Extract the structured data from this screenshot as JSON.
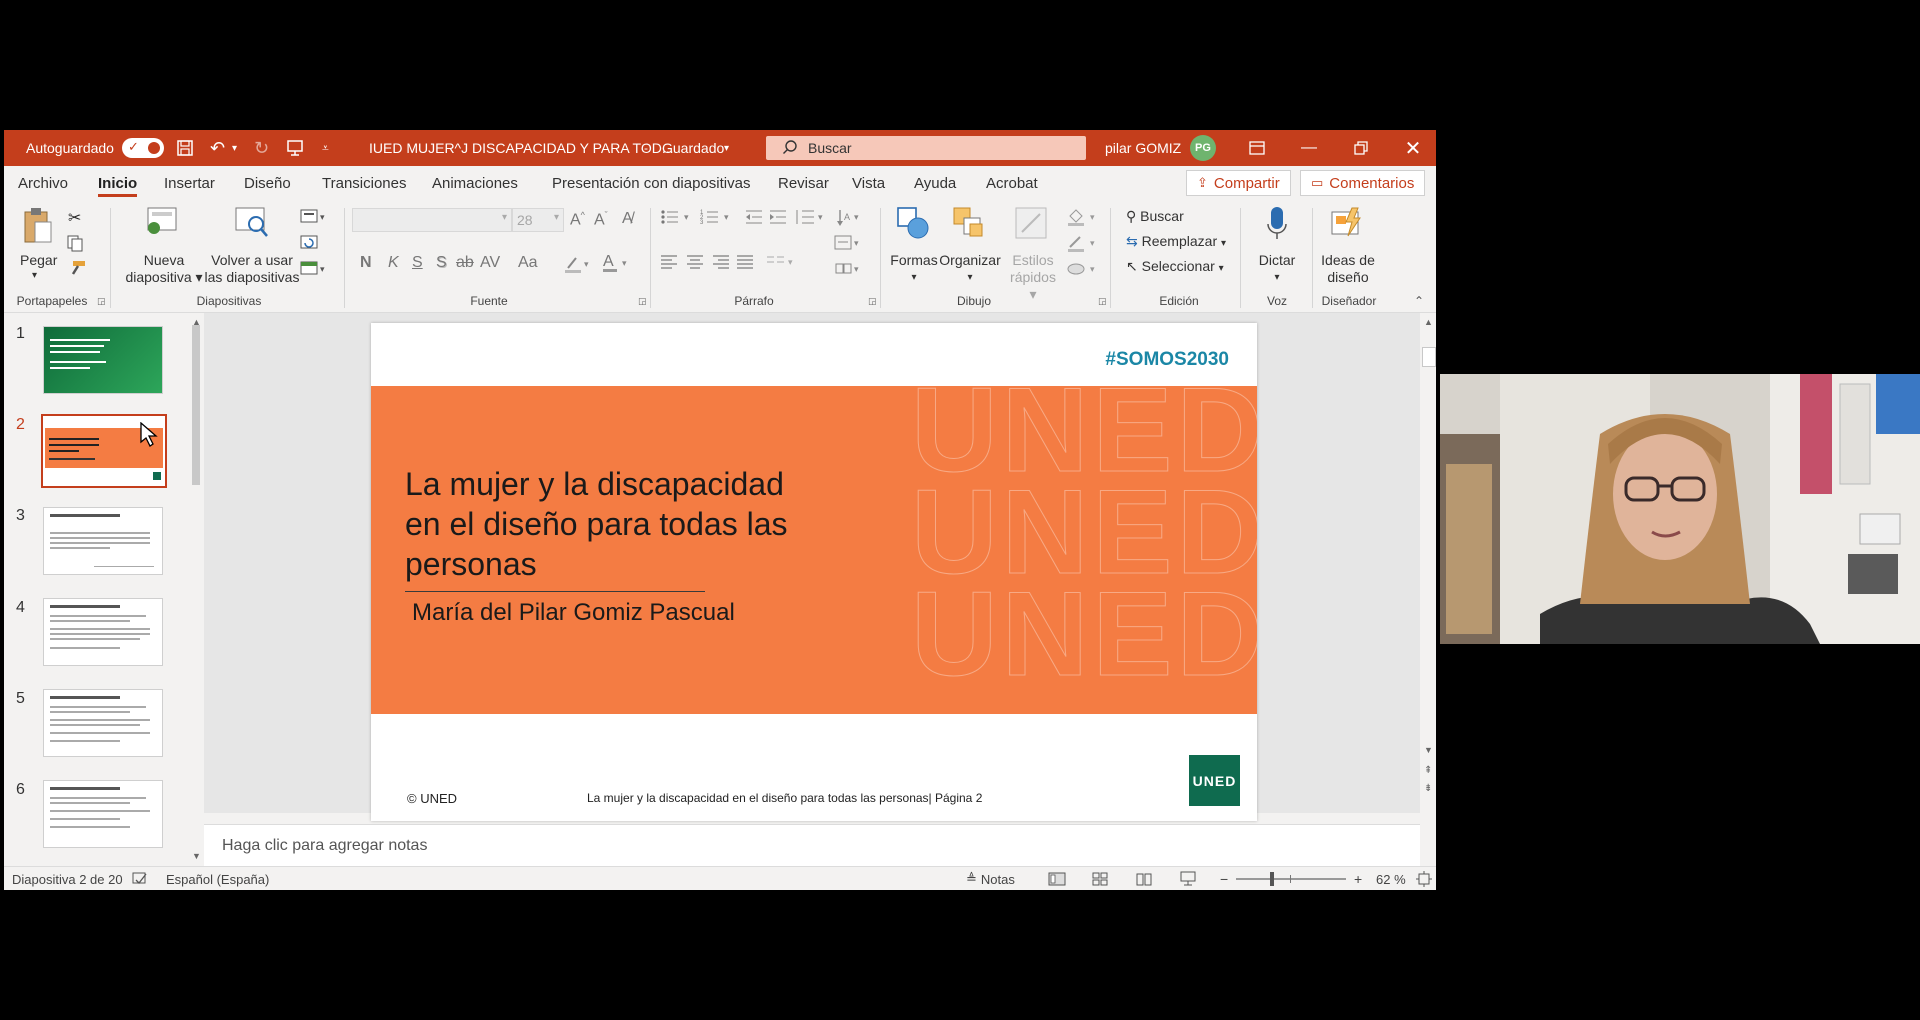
{
  "titlebar": {
    "autosave_label": "Autoguardado",
    "doc_title": "IUED MUJER^J DISCAPACIDAD Y PARA TOD...",
    "saved_status": "Guardado",
    "search_placeholder": "Buscar",
    "user_name": "pilar GOMIZ",
    "user_initials": "PG"
  },
  "menu": {
    "tabs": [
      "Archivo",
      "Inicio",
      "Insertar",
      "Diseño",
      "Transiciones",
      "Animaciones",
      "Presentación con diapositivas",
      "Revisar",
      "Vista",
      "Ayuda",
      "Acrobat"
    ],
    "active_tab": "Inicio",
    "share_label": "Compartir",
    "comments_label": "Comentarios"
  },
  "ribbon": {
    "paste_label": "Pegar",
    "new_slide_line1": "Nueva",
    "new_slide_line2": "diapositiva",
    "reuse_line1": "Volver a usar",
    "reuse_line2": "las diapositivas",
    "font_size": "28",
    "shapes_label": "Formas",
    "arrange_label": "Organizar",
    "styles_line1": "Estilos",
    "styles_line2": "rápidos",
    "find_label": "Buscar",
    "replace_label": "Reemplazar",
    "select_label": "Seleccionar",
    "dictate_label": "Dictar",
    "ideas_line1": "Ideas de",
    "ideas_line2": "diseño",
    "groups": {
      "clipboard": "Portapapeles",
      "slides": "Diapositivas",
      "font": "Fuente",
      "paragraph": "Párrafo",
      "drawing": "Dibujo",
      "editing": "Edición",
      "voice": "Voz",
      "designer": "Diseñador"
    },
    "format_buttons": [
      "N",
      "K",
      "S",
      "S",
      "ab",
      "AV",
      "Aa"
    ]
  },
  "thumbnails": {
    "numbers": [
      "1",
      "2",
      "3",
      "4",
      "5",
      "6"
    ],
    "selected": "2"
  },
  "slide": {
    "hashtag": "#SOMOS2030",
    "title": "La mujer y la discapacidad en el diseño para todas las personas",
    "author": "María del Pilar Gomiz Pascual",
    "copyright": "© UNED",
    "footer": "La mujer y la discapacidad en el diseño para todas las personas| Página 2",
    "logo_text": "UNED",
    "colors": {
      "band": "#f47c43",
      "hashtag": "#1b87a6",
      "logo_bg": "#0f6b4f"
    }
  },
  "notes": {
    "placeholder": "Haga clic para agregar notas"
  },
  "status": {
    "slide_counter": "Diapositiva 2 de 20",
    "language": "Español (España)",
    "notes_label": "Notas",
    "zoom": "62 %"
  },
  "theme": {
    "accent": "#c43e1c"
  }
}
